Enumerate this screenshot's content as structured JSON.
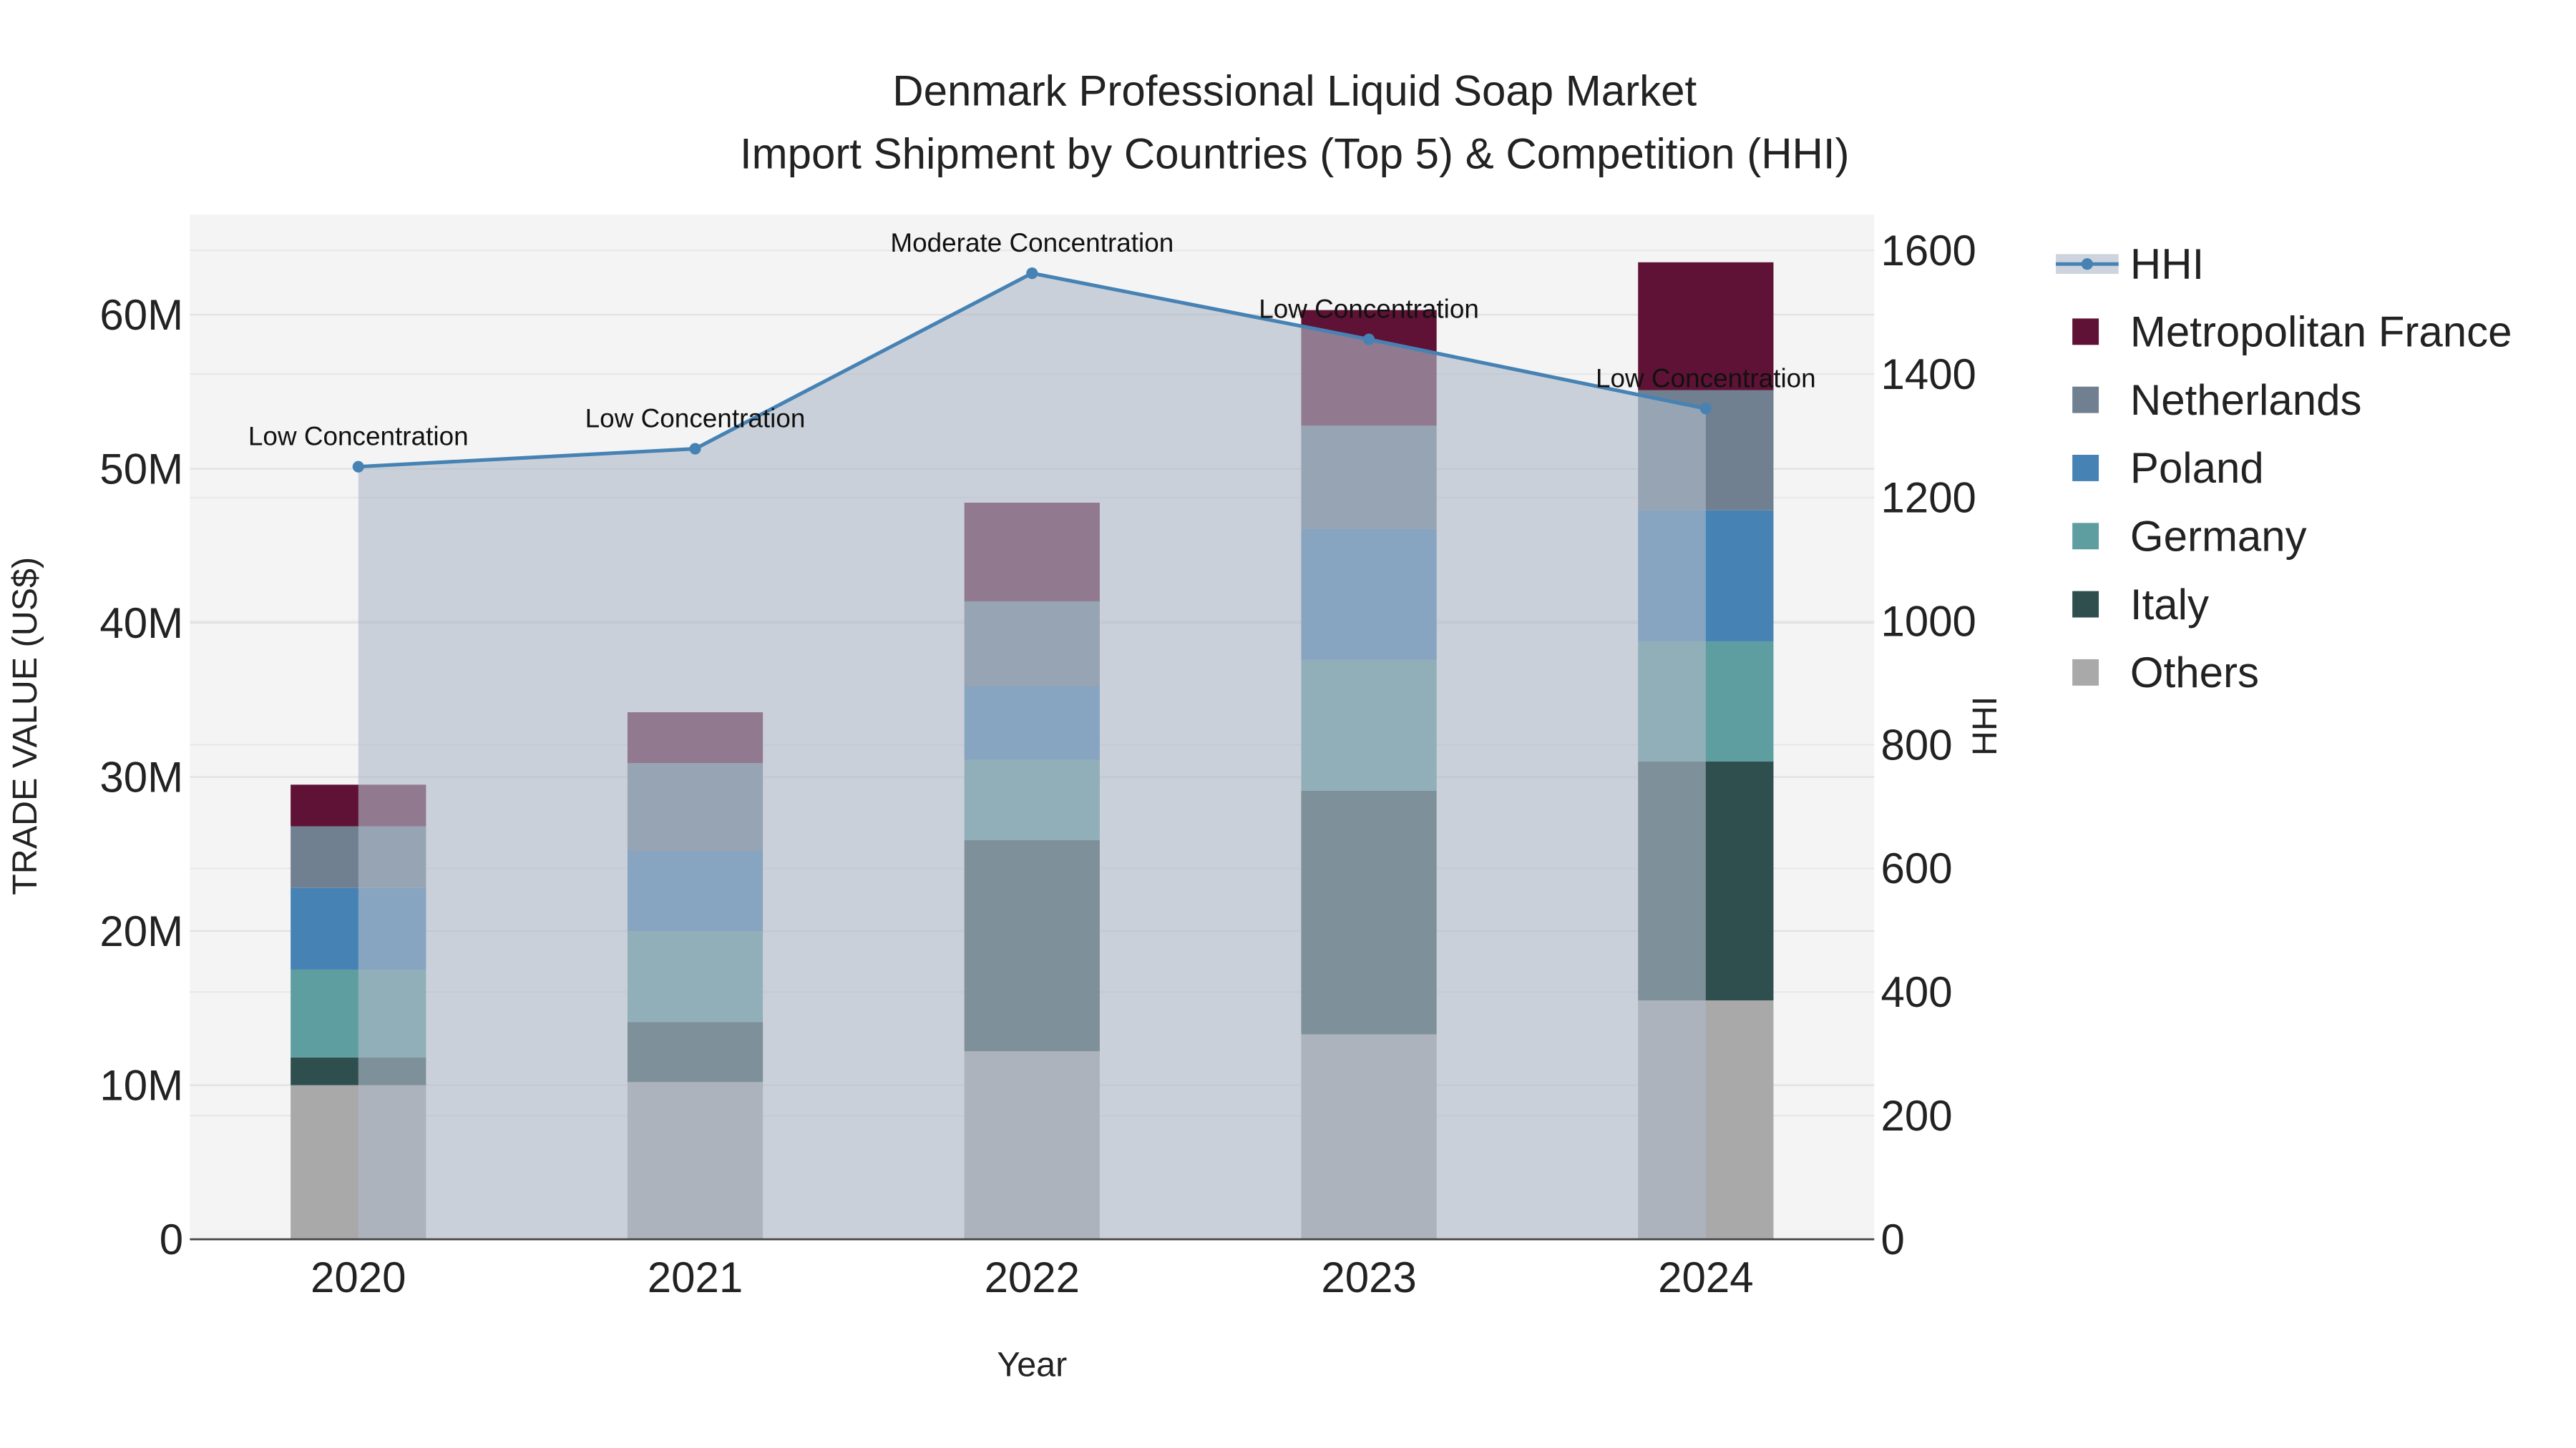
{
  "chart_data": {
    "type": "bar",
    "stacked": true,
    "title": "Denmark Professional Liquid Soap Market",
    "subtitle": "Import Shipment by Countries (Top 5) & Competition (HHI)",
    "xlabel": "Year",
    "ylabel": "TRADE VALUE (US$)",
    "y2label": "HHI",
    "categories": [
      "2020",
      "2021",
      "2022",
      "2023",
      "2024"
    ],
    "ylim": [
      0,
      66500000
    ],
    "y_ticks": [
      0,
      10000000,
      20000000,
      30000000,
      40000000,
      50000000,
      60000000
    ],
    "y_tick_labels": [
      "0",
      "10M",
      "20M",
      "30M",
      "40M",
      "50M",
      "60M"
    ],
    "y2lim": [
      0,
      1658
    ],
    "y2_ticks": [
      0,
      200,
      400,
      600,
      800,
      1000,
      1200,
      1400,
      1600
    ],
    "grid": true,
    "legend_position": "right",
    "series": [
      {
        "name": "Others",
        "color": "#a9a9a9",
        "values": [
          10000000,
          10200000,
          12200000,
          13300000,
          15500000
        ]
      },
      {
        "name": "Italy",
        "color": "#2f4f4f",
        "values": [
          1800000,
          3900000,
          13700000,
          15800000,
          15500000
        ]
      },
      {
        "name": "Germany",
        "color": "#5f9ea0",
        "values": [
          5700000,
          5900000,
          5200000,
          8500000,
          7800000
        ]
      },
      {
        "name": "Poland",
        "color": "#4682b4",
        "values": [
          5300000,
          5200000,
          4800000,
          8500000,
          8500000
        ]
      },
      {
        "name": "Netherlands",
        "color": "#708090",
        "values": [
          4000000,
          5700000,
          5500000,
          6700000,
          7800000
        ]
      },
      {
        "name": "Metropolitan France",
        "color": "#5f1235",
        "values": [
          2700000,
          3300000,
          6400000,
          7500000,
          8300000
        ]
      }
    ],
    "hhi": {
      "name": "HHI",
      "color": "#4682b4",
      "values": [
        1250,
        1279,
        1563,
        1456,
        1344
      ],
      "annotations": [
        "Low Concentration",
        "Low Concentration",
        "Moderate Concentration",
        "Low Concentration",
        "Low Concentration"
      ]
    },
    "legend_order": [
      "HHI",
      "Metropolitan France",
      "Netherlands",
      "Poland",
      "Germany",
      "Italy",
      "Others"
    ]
  }
}
